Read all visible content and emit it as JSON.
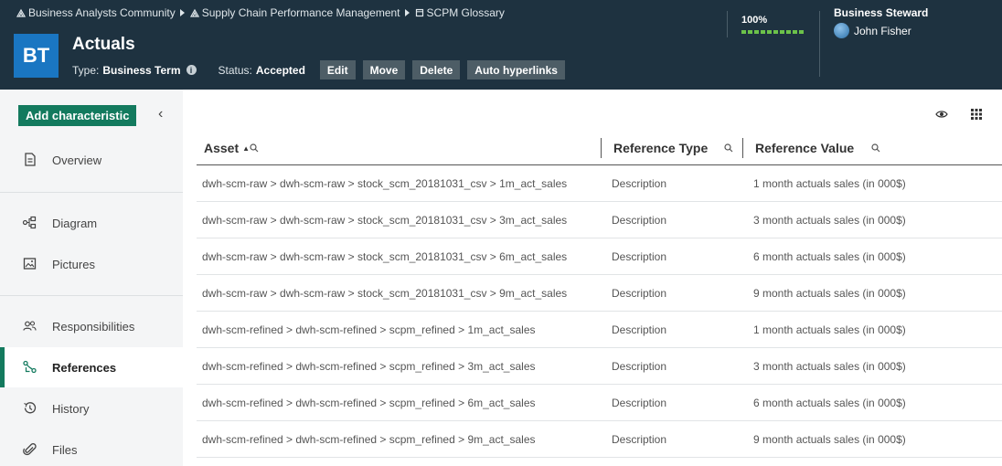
{
  "header": {
    "breadcrumbs": [
      "Business Analysts Community",
      "Supply Chain Performance Management",
      "SCPM Glossary"
    ],
    "badge": "BT",
    "title": "Actuals",
    "type_label": "Type:",
    "type_value": "Business Term",
    "status_label": "Status:",
    "status_value": "Accepted",
    "buttons": [
      "Edit",
      "Move",
      "Delete",
      "Auto hyperlinks"
    ],
    "progress": "100%",
    "progress_fraction": 1.0,
    "steward_label": "Business Steward",
    "steward_name": "John Fisher",
    "colors": {
      "header_bg": "#1e3240",
      "badge_bg": "#1a76c2",
      "progress": "#6cc24a",
      "accent": "#137a5e"
    }
  },
  "sidebar": {
    "add_label": "Add characteristic",
    "items": [
      {
        "label": "Overview",
        "icon": "document-icon"
      },
      {
        "label": "Diagram",
        "icon": "diagram-icon"
      },
      {
        "label": "Pictures",
        "icon": "picture-icon"
      },
      {
        "label": "Responsibilities",
        "icon": "people-icon"
      },
      {
        "label": "References",
        "icon": "references-icon",
        "active": true
      },
      {
        "label": "History",
        "icon": "history-icon"
      },
      {
        "label": "Files",
        "icon": "paperclip-icon"
      }
    ]
  },
  "table": {
    "columns": [
      "Asset",
      "Reference Type",
      "Reference Value"
    ],
    "rows": [
      [
        "dwh-scm-raw > dwh-scm-raw > stock_scm_20181031_csv > 1m_act_sales",
        "Description",
        "1 month actuals sales (in 000$)"
      ],
      [
        "dwh-scm-raw > dwh-scm-raw > stock_scm_20181031_csv > 3m_act_sales",
        "Description",
        "3 month actuals sales (in 000$)"
      ],
      [
        "dwh-scm-raw > dwh-scm-raw > stock_scm_20181031_csv > 6m_act_sales",
        "Description",
        "6 month actuals sales (in 000$)"
      ],
      [
        "dwh-scm-raw > dwh-scm-raw > stock_scm_20181031_csv > 9m_act_sales",
        "Description",
        "9 month actuals sales (in 000$)"
      ],
      [
        "dwh-scm-refined > dwh-scm-refined > scpm_refined > 1m_act_sales",
        "Description",
        "1 month actuals sales (in 000$)"
      ],
      [
        "dwh-scm-refined > dwh-scm-refined > scpm_refined > 3m_act_sales",
        "Description",
        "3 month actuals sales (in 000$)"
      ],
      [
        "dwh-scm-refined > dwh-scm-refined > scpm_refined > 6m_act_sales",
        "Description",
        "6 month actuals sales (in 000$)"
      ],
      [
        "dwh-scm-refined > dwh-scm-refined > scpm_refined > 9m_act_sales",
        "Description",
        "9 month actuals sales (in 000$)"
      ]
    ]
  }
}
